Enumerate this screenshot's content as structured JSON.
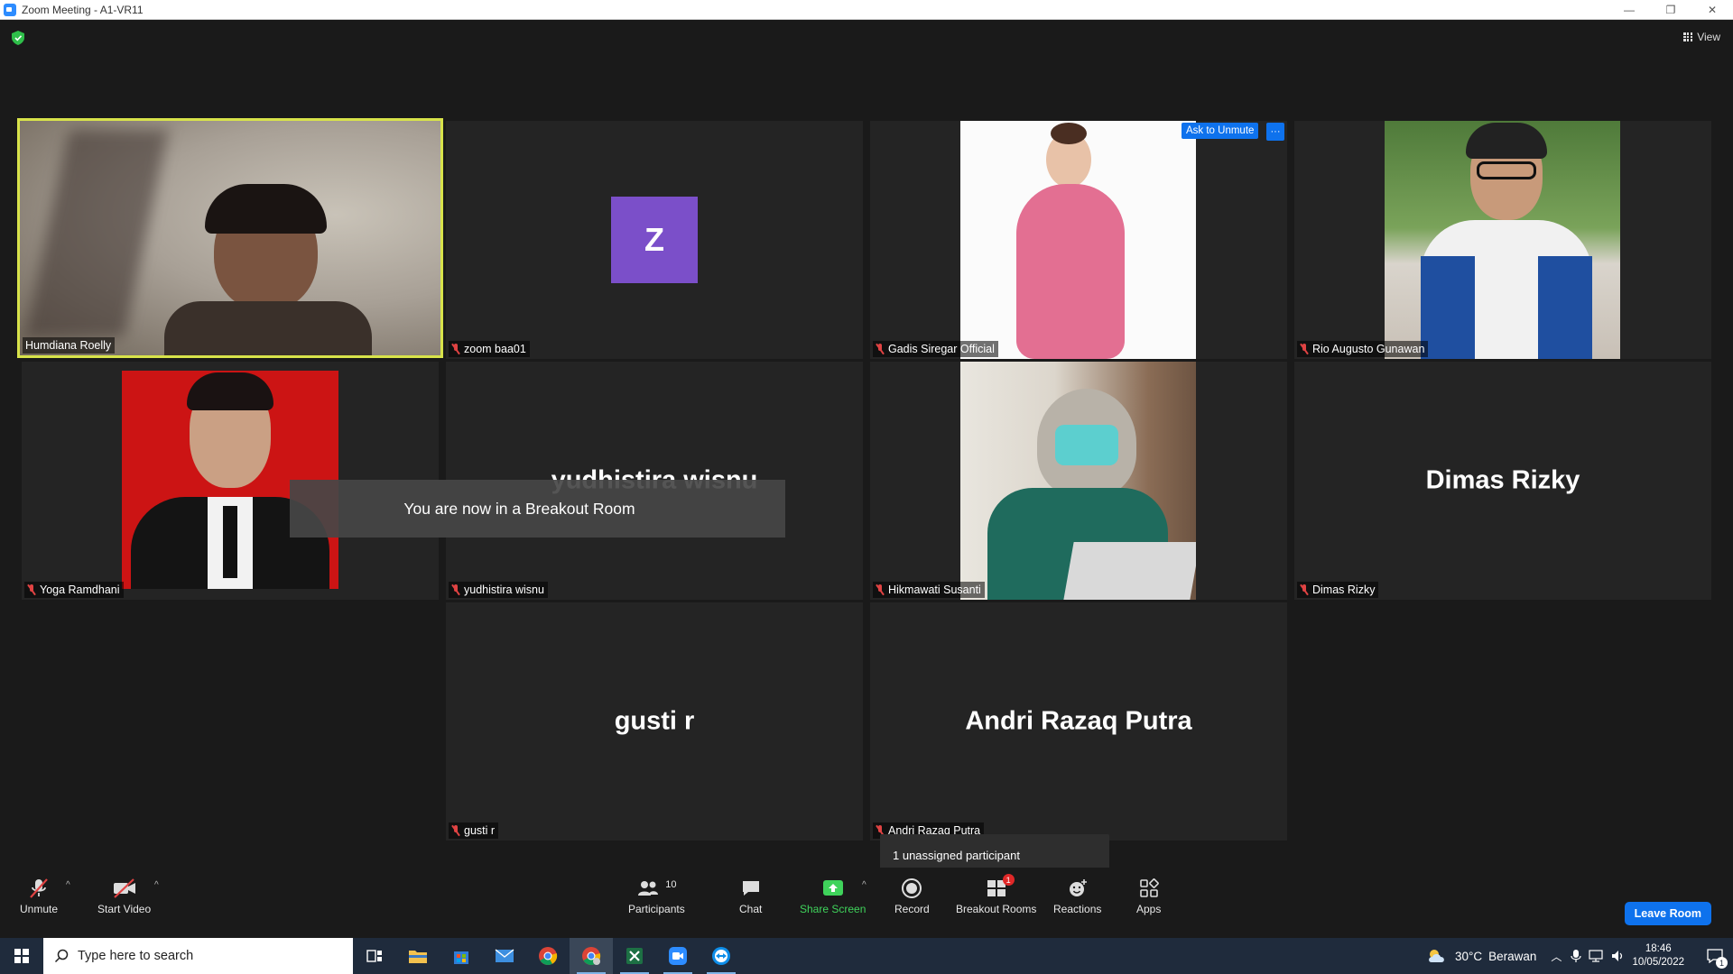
{
  "window": {
    "title": "Zoom Meeting - A1-VR11",
    "minimize": "—",
    "restore": "❐",
    "close": "✕"
  },
  "view_button": {
    "label": "View"
  },
  "participants": [
    {
      "id": "humdiana",
      "name": "Humdiana Roelly",
      "muted": false,
      "active_speaker": true
    },
    {
      "id": "zoom-baa01",
      "name": "zoom baa01",
      "muted": true,
      "avatar_letter": "Z"
    },
    {
      "id": "gadis",
      "name": "Gadis Siregar Official",
      "muted": true
    },
    {
      "id": "rio",
      "name": "Rio Augusto Gunawan",
      "muted": true
    },
    {
      "id": "yoga",
      "name": "Yoga Ramdhani",
      "muted": true
    },
    {
      "id": "yudhistira",
      "name": "yudhistira wisnu",
      "muted": true,
      "big_name": "yudhistira wisnu"
    },
    {
      "id": "hikmawati",
      "name": "Hikmawati Susanti",
      "muted": true
    },
    {
      "id": "dimas",
      "name": "Dimas Rizky",
      "muted": true,
      "big_name": "Dimas Rizky"
    },
    {
      "id": "gusti",
      "name": "gusti r",
      "muted": true,
      "big_name": "gusti r"
    },
    {
      "id": "andri",
      "name": "Andri Razaq Putra",
      "muted": true,
      "big_name": "Andri Razaq Putra"
    }
  ],
  "ask_to_unmute": {
    "label": "Ask to Unmute",
    "more": "···"
  },
  "toast": {
    "text": "You are now in a Breakout Room"
  },
  "tooltip": {
    "text": "1 unassigned participant"
  },
  "toolbar": {
    "unmute": "Unmute",
    "start_video": "Start Video",
    "participants": "Participants",
    "participants_count": "10",
    "chat": "Chat",
    "share_screen": "Share Screen",
    "record": "Record",
    "breakout_rooms": "Breakout Rooms",
    "breakout_badge": "1",
    "reactions": "Reactions",
    "apps": "Apps",
    "leave": "Leave Room",
    "caret": "^"
  },
  "taskbar": {
    "search_placeholder": "Type here to search",
    "weather_temp": "30°C",
    "weather_text": "Berawan",
    "time": "18:46",
    "date": "10/05/2022",
    "notification_count": "1"
  },
  "colors": {
    "accent_blue": "#0e72ed",
    "active_speaker_border": "#d8e34a",
    "share_green": "#3fd35b",
    "muted_red": "#e04343",
    "avatar_purple": "#7b4fc9"
  }
}
